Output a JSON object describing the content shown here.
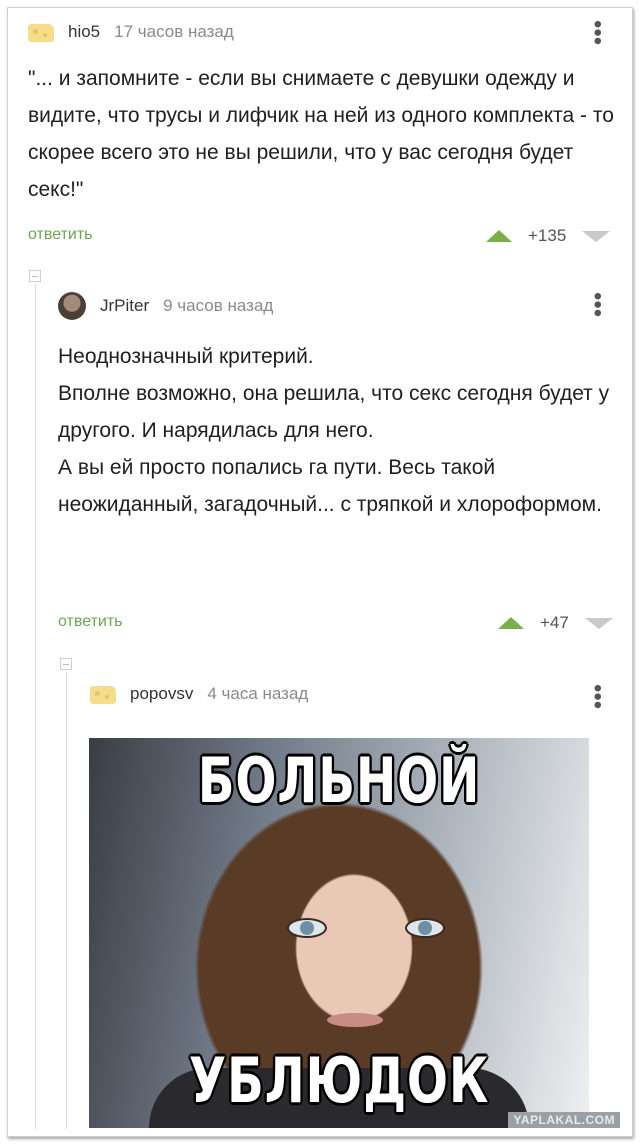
{
  "comments": [
    {
      "username": "hio5",
      "time": "17 часов назад",
      "text": "\"... и запомните - если вы снимаете с девушки одежду и видите, что трусы и лифчик на ней из одного комплекта - то скорее всего это не вы решили, что у вас сегодня будет секс!\"",
      "reply_label": "ответить",
      "score": "+135",
      "avatar_icon": "cheese-avatar-icon"
    },
    {
      "username": "JrPiter",
      "time": "9 часов назад",
      "text": "Неоднозначный критерий.\nВполне возможно, она решила, что секс сегодня будет у другого. И нарядилась для него.\nА вы ей просто попались га пути. Весь такой неожиданный, загадочный... с тряпкой и хлороформом.",
      "reply_label": "ответить",
      "score": "+47",
      "avatar_icon": "user-photo-avatar"
    },
    {
      "username": "popovsv",
      "time": "4 часа назад",
      "avatar_icon": "cheese-avatar-icon",
      "image": {
        "caption_top": "БОЛЬНОЙ",
        "caption_bottom": "УБЛЮДОК"
      }
    }
  ],
  "watermark": "YAPLAKAL.COM",
  "colors": {
    "accent_green": "#6aa84f",
    "upvote": "#79b04a",
    "downvote": "#c9c9c9"
  }
}
